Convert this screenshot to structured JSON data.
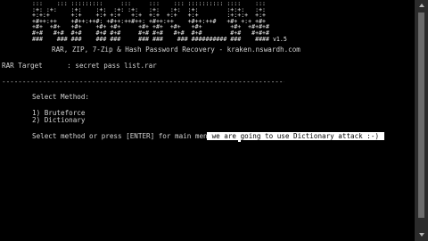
{
  "banner": {
    "ascii_art": ":::    ::: :::::::::     :::     :::    ::: :::::::::: ::::    :::\n:+: :+:    :+:    :+:  :+: :+:   :+:   :+:  :+:        :+:+:   :+:\n+:+:+      +:+    +:+ +:+   +:+  +:+  +:+   +:+        :+:+:+  +:+\n+#++:++    +#++:++#: +#++:++#++: +#++:++    +#++:++#   +#+ +:+ +#+\n+#+  +#+   +#+    +#+ +#+     +#+ +#+  +#+   +#+        +#+  +#+#+#\n#+#   #+#  #+#    #+# #+#     #+# #+#   #+#  #+#        #+#   #+#+#\n###    ### ###    ### ###     ### ###    ### ########## ###    #### v1.5",
    "subtitle": "RAR, ZIP, 7-Zip & Hash Password Recovery - kraken.nswardh.com"
  },
  "target": {
    "text": "RAR Target      : secret pass list.rar"
  },
  "divider": {
    "text": "-----------------------------------------------------------------------------------------------------"
  },
  "menu": {
    "heading": "Select Method:",
    "options": [
      "1) Bruteforce",
      "2) Dictionary"
    ],
    "prompt": "Select method or press [ENTER] for main menu:",
    "input_value": " we are going to use Dictionary attack :-) "
  },
  "colors": {
    "background": "#000000",
    "text": "#d4d4d4",
    "input_highlight": "#ffffff"
  }
}
